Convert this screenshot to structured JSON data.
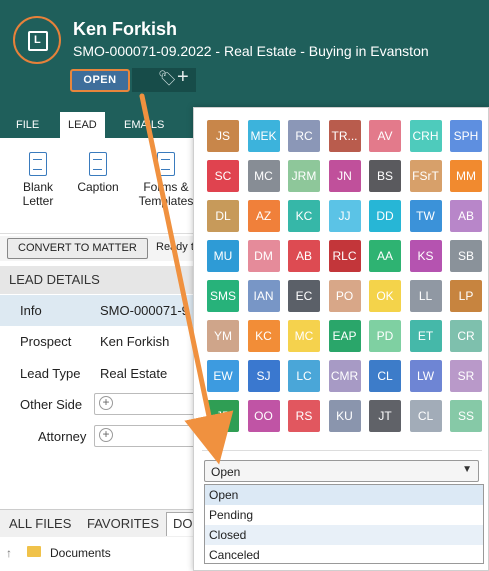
{
  "header": {
    "name": "Ken Forkish",
    "subtitle": "SMO-000071-09.2022 - Real Estate - Buying in Evanston",
    "status_label": "OPEN",
    "logo_letter": "L"
  },
  "tabs": [
    "FILE",
    "LEAD",
    "EMAILS"
  ],
  "ribbon": [
    {
      "label1": "Blank",
      "label2": "Letter"
    },
    {
      "label1": "Caption",
      "label2": ""
    },
    {
      "label1": "Forms &",
      "label2": "Templates"
    }
  ],
  "convert_button": "CONVERT TO MATTER",
  "ready_text": "Ready t",
  "lead_details": {
    "heading": "LEAD DETAILS",
    "rows": [
      {
        "label": "Info",
        "value": "SMO-000071-9"
      },
      {
        "label": "Prospect",
        "value": "Ken Forkish"
      },
      {
        "label": "Lead Type",
        "value": "Real Estate"
      },
      {
        "label": "Other Side",
        "value": ""
      },
      {
        "label": "Attorney",
        "value": ""
      }
    ]
  },
  "files": {
    "tabs": [
      "ALL FILES",
      "FAVORITES",
      "DO"
    ],
    "documents_label": "Documents"
  },
  "colors": {
    "header_bg": "#1f5f5b",
    "status_bg": "#3e6e9b",
    "accent_orange": "#e8863c"
  },
  "swatches": [
    {
      "label": "JS",
      "color": "#c8864a"
    },
    {
      "label": "MEK",
      "color": "#3cb3dc"
    },
    {
      "label": "RC",
      "color": "#8b97b7"
    },
    {
      "label": "TR...",
      "color": "#b95c4d"
    },
    {
      "label": "AV",
      "color": "#e37a8b"
    },
    {
      "label": "CRH",
      "color": "#4ecbbc"
    },
    {
      "label": "SPH",
      "color": "#5e8fe0"
    },
    {
      "label": "SC",
      "color": "#e0434f"
    },
    {
      "label": "MC",
      "color": "#878d95"
    },
    {
      "label": "JRM",
      "color": "#8ec79a"
    },
    {
      "label": "JN",
      "color": "#c0509b"
    },
    {
      "label": "BS",
      "color": "#5a5a5e"
    },
    {
      "label": "FSrT",
      "color": "#d7a06a"
    },
    {
      "label": "MM",
      "color": "#f18a2f"
    },
    {
      "label": "DL",
      "color": "#c79a5a"
    },
    {
      "label": "AZ",
      "color": "#f0803a"
    },
    {
      "label": "KC",
      "color": "#36b7a8"
    },
    {
      "label": "JJ",
      "color": "#5bc3e6"
    },
    {
      "label": "DD",
      "color": "#27b6d6"
    },
    {
      "label": "TW",
      "color": "#3b92d9"
    },
    {
      "label": "AB",
      "color": "#b886c9"
    },
    {
      "label": "MU",
      "color": "#2e9bd6"
    },
    {
      "label": "DM",
      "color": "#e58b9a"
    },
    {
      "label": "AB",
      "color": "#dd4b52"
    },
    {
      "label": "RLC",
      "color": "#c3363a"
    },
    {
      "label": "AA",
      "color": "#2eb372"
    },
    {
      "label": "KS",
      "color": "#b553b0"
    },
    {
      "label": "SB",
      "color": "#8a929a"
    },
    {
      "label": "SMS",
      "color": "#27b27a"
    },
    {
      "label": "IAN",
      "color": "#7896c6"
    },
    {
      "label": "EC",
      "color": "#5b6068"
    },
    {
      "label": "PO",
      "color": "#d8a788"
    },
    {
      "label": "OK",
      "color": "#f4d34a"
    },
    {
      "label": "LL",
      "color": "#9098a3"
    },
    {
      "label": "LP",
      "color": "#c7843f"
    },
    {
      "label": "YM",
      "color": "#cfa58a"
    },
    {
      "label": "KC",
      "color": "#f28d37"
    },
    {
      "label": "MC",
      "color": "#f5d24d"
    },
    {
      "label": "EAP",
      "color": "#2aa66a"
    },
    {
      "label": "PD",
      "color": "#7fd0a2"
    },
    {
      "label": "ET",
      "color": "#45b8a9"
    },
    {
      "label": "CR",
      "color": "#7ec0ad"
    },
    {
      "label": "EW",
      "color": "#3d9be0"
    },
    {
      "label": "SJ",
      "color": "#3a78cf"
    },
    {
      "label": "LC",
      "color": "#4aa6d8"
    },
    {
      "label": "CMR",
      "color": "#a79ac5"
    },
    {
      "label": "CL",
      "color": "#3d7cc9"
    },
    {
      "label": "LW",
      "color": "#6e85d4"
    },
    {
      "label": "SR",
      "color": "#b999c9"
    },
    {
      "label": "JP",
      "color": "#2f9e54"
    },
    {
      "label": "OO",
      "color": "#c054a5"
    },
    {
      "label": "RS",
      "color": "#e1575f"
    },
    {
      "label": "KU",
      "color": "#8a95ad"
    },
    {
      "label": "JT",
      "color": "#606268"
    },
    {
      "label": "CL",
      "color": "#a2acb8"
    },
    {
      "label": "SS",
      "color": "#86c9a7"
    }
  ],
  "status_select": {
    "value": "Open",
    "options": [
      "Open",
      "Pending",
      "Closed",
      "Canceled"
    ]
  }
}
